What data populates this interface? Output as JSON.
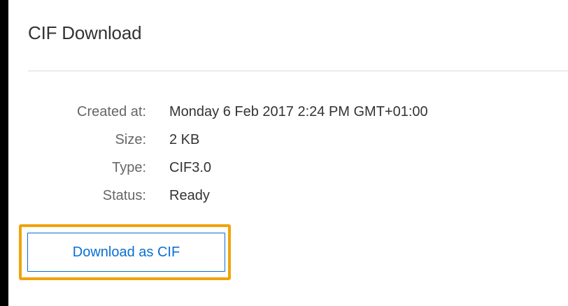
{
  "header": {
    "title": "CIF Download"
  },
  "details": [
    {
      "label": "Created at:",
      "value": "Monday 6 Feb 2017 2:24 PM GMT+01:00"
    },
    {
      "label": "Size:",
      "value": "2 KB"
    },
    {
      "label": "Type:",
      "value": "CIF3.0"
    },
    {
      "label": "Status:",
      "value": "Ready"
    }
  ],
  "actions": {
    "download_label": "Download as CIF"
  },
  "colors": {
    "accent": "#0a6ed1",
    "highlight": "#f0a30a",
    "background": "#ffffff",
    "frame": "#000000"
  }
}
